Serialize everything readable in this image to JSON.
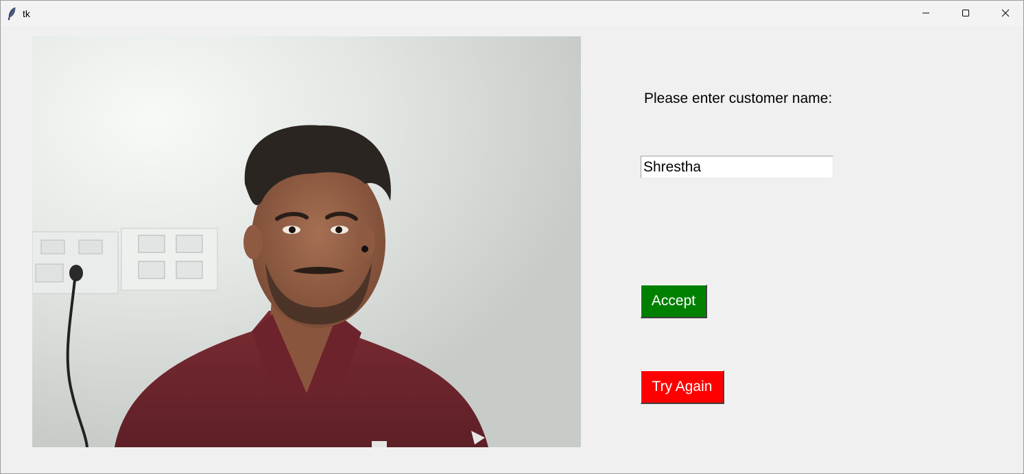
{
  "window": {
    "title": "tk",
    "controls": {
      "minimize_icon": "minimize-icon",
      "maximize_icon": "maximize-icon",
      "close_icon": "close-icon"
    }
  },
  "form": {
    "prompt": "Please enter customer name:",
    "name_value": "Shrestha",
    "accept_label": "Accept",
    "try_again_label": "Try Again"
  },
  "colors": {
    "accept_bg": "#008000",
    "try_again_bg": "#ff0000",
    "window_bg": "#f0f0f0"
  }
}
